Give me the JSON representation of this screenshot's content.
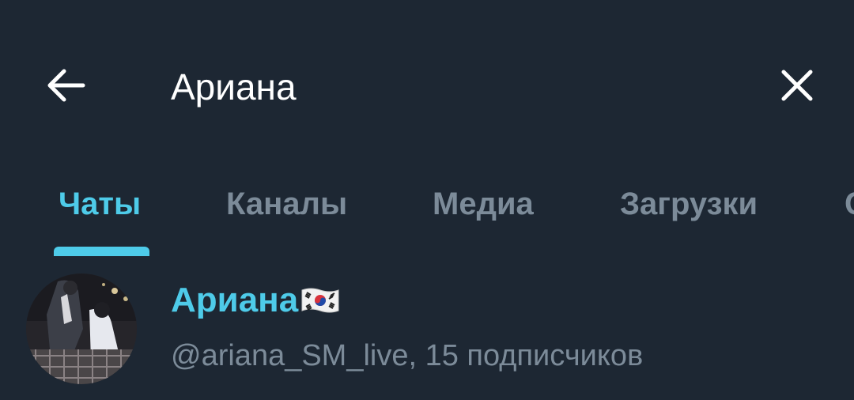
{
  "search": {
    "query": "Ариана"
  },
  "icons": {
    "back": "arrow-left-icon",
    "clear": "close-icon"
  },
  "tabs": [
    {
      "label": "Чаты",
      "active": true
    },
    {
      "label": "Каналы",
      "active": false
    },
    {
      "label": "Медиа",
      "active": false
    },
    {
      "label": "Загрузки",
      "active": false
    },
    {
      "label": "С",
      "active": false
    }
  ],
  "results": [
    {
      "title": "Ариана",
      "subtitle": "@ariana_SM_live, 15 подписчиков",
      "flag": "south-korea-flag"
    }
  ],
  "colors": {
    "background": "#1d2733",
    "accent": "#4ecbe9",
    "muted": "#7c8b99",
    "text": "#ffffff"
  }
}
